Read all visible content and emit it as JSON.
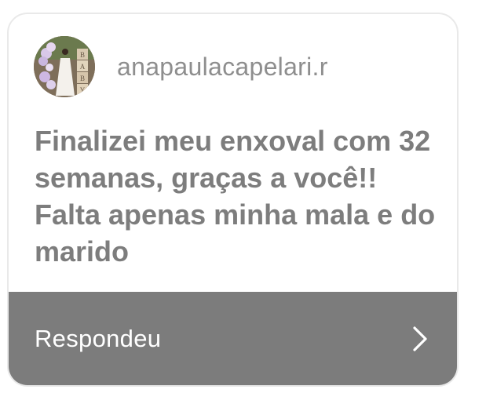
{
  "story_reply": {
    "username": "anapaulacapelari.r",
    "message": "Finalizei meu enxoval com 32 semanas, graças a você!! Falta apenas minha mala e do marido",
    "footer_label": "Respondeu",
    "footer_icon": "chevron-right-icon",
    "avatar_blocks": [
      "B",
      "A",
      "B",
      "Y"
    ]
  },
  "colors": {
    "card_border": "#e9e9e9",
    "text_gray": "#7d7d7d",
    "username_gray": "#8e8e8e",
    "footer_bg": "#7c7c7c",
    "footer_text": "#ffffff"
  }
}
